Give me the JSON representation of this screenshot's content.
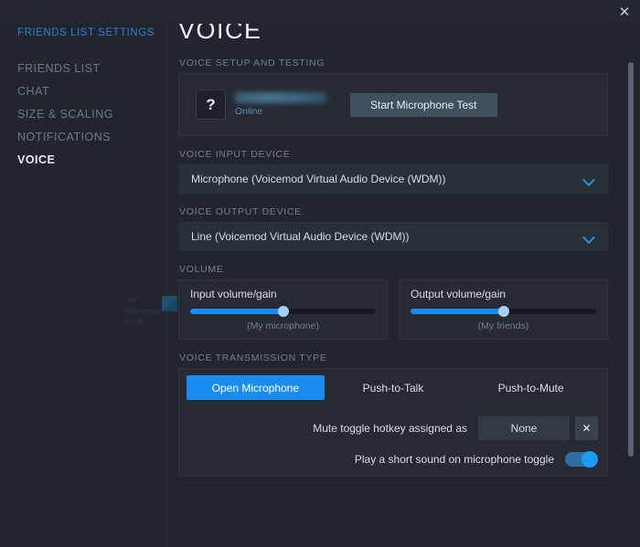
{
  "window": {
    "close_icon": "close-icon"
  },
  "sidebar": {
    "title": "FRIENDS LIST SETTINGS",
    "items": [
      {
        "label": "FRIENDS LIST",
        "active": false
      },
      {
        "label": "CHAT",
        "active": false
      },
      {
        "label": "SIZE & SCALING",
        "active": false
      },
      {
        "label": "NOTIFICATIONS",
        "active": false
      },
      {
        "label": "VOICE",
        "active": true
      }
    ]
  },
  "watermark": {
    "line1": "The",
    "line2": "Windows Club"
  },
  "page": {
    "title": "VOICE"
  },
  "voice_setup": {
    "section_label": "VOICE SETUP AND TESTING",
    "avatar_glyph": "?",
    "user_name": "",
    "user_status": "Online",
    "test_button": "Start Microphone Test"
  },
  "input_device": {
    "section_label": "VOICE INPUT DEVICE",
    "value": "Microphone (Voicemod Virtual Audio Device (WDM))"
  },
  "output_device": {
    "section_label": "VOICE OUTPUT DEVICE",
    "value": "Line (Voicemod Virtual Audio Device (WDM))"
  },
  "volume": {
    "section_label": "VOLUME",
    "input": {
      "label": "Input volume/gain",
      "sub": "(My microphone)",
      "percent": 50
    },
    "output": {
      "label": "Output volume/gain",
      "sub": "(My friends)",
      "percent": 50
    }
  },
  "transmission": {
    "section_label": "VOICE TRANSMISSION TYPE",
    "tabs": [
      {
        "label": "Open Microphone",
        "active": true
      },
      {
        "label": "Push-to-Talk",
        "active": false
      },
      {
        "label": "Push-to-Mute",
        "active": false
      }
    ],
    "hotkey_label": "Mute toggle hotkey assigned as",
    "hotkey_value": "None",
    "hotkey_clear_icon": "close-icon",
    "sound_label": "Play a short sound on microphone toggle",
    "sound_enabled": true
  },
  "colors": {
    "accent": "#1a8cf0",
    "link": "#2f7fd4",
    "panel": "#262b33",
    "background": "#21262e"
  }
}
